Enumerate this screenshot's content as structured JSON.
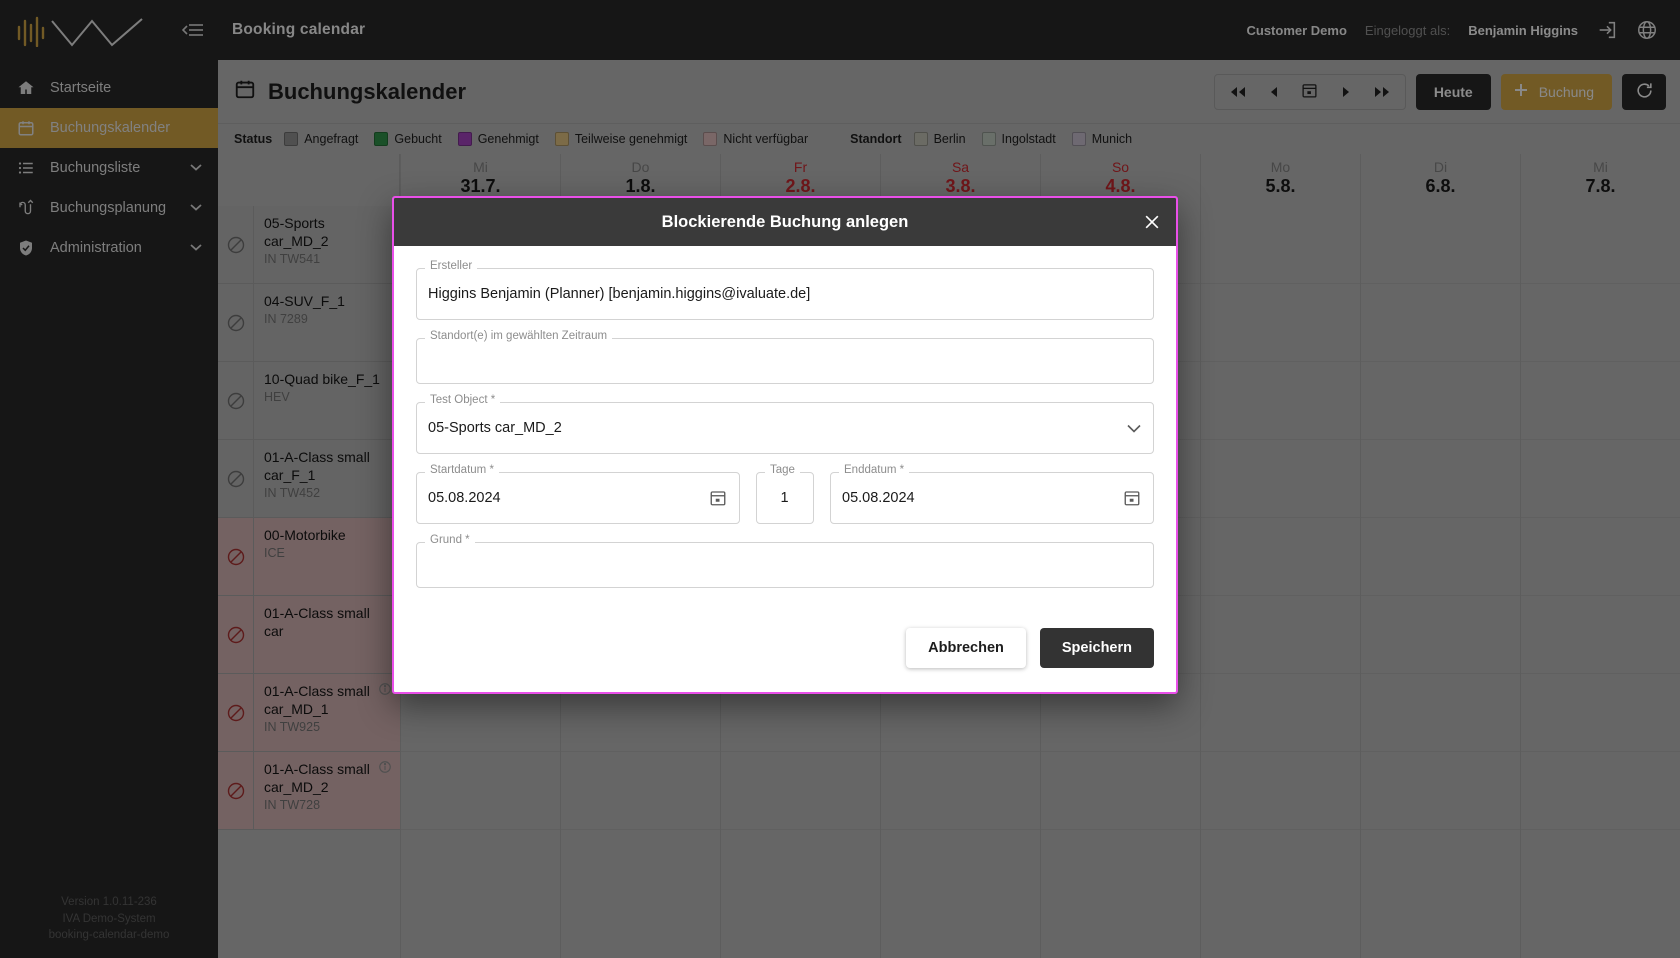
{
  "sidebar": {
    "logo_name": "iva-logo",
    "collapse_label": "collapse-sidebar",
    "items": [
      {
        "label": "Startseite",
        "icon": "home-icon",
        "active": false,
        "expandable": false
      },
      {
        "label": "Buchungskalender",
        "icon": "calendar-icon",
        "active": true,
        "expandable": false
      },
      {
        "label": "Buchungsliste",
        "icon": "list-icon",
        "active": false,
        "expandable": true
      },
      {
        "label": "Buchungsplanung",
        "icon": "shuffle-icon",
        "active": false,
        "expandable": true
      },
      {
        "label": "Administration",
        "icon": "shield-check-icon",
        "active": false,
        "expandable": true
      }
    ],
    "footer": {
      "version": "Version 1.0.11-236",
      "system": "IVA Demo-System",
      "tenant": "booking-calendar-demo"
    }
  },
  "topbar": {
    "title": "Booking calendar",
    "customer": "Customer Demo",
    "logged_in_label": "Eingeloggt als:",
    "user": "Benjamin Higgins",
    "logout_icon": "logout-icon",
    "language_icon": "globe-icon"
  },
  "page": {
    "title": "Buchungskalender",
    "title_icon": "calendar-icon",
    "nav": {
      "first_label": "◀◀",
      "prev_label": "◀",
      "today_picker_icon": "calendar-picker-icon",
      "next_label": "▶",
      "last_label": "▶▶"
    },
    "today_button": "Heute",
    "new_booking_button": "Buchung",
    "refresh_icon": "refresh-icon"
  },
  "legend": {
    "status_label": "Status",
    "statuses": [
      {
        "label": "Angefragt",
        "color": "#8b8b8b"
      },
      {
        "label": "Gebucht",
        "color": "#2e8b45"
      },
      {
        "label": "Genehmigt",
        "color": "#9b3fb5"
      },
      {
        "label": "Teilweise genehmigt",
        "color": "#d6b97b"
      },
      {
        "label": "Nicht verfügbar",
        "color": "#d2b2b2"
      }
    ],
    "location_label": "Standort",
    "locations": [
      {
        "label": "Berlin",
        "color": "#b8b8ad"
      },
      {
        "label": "Ingolstadt",
        "color": "#b6c0b6"
      },
      {
        "label": "Munich",
        "color": "#bdb6c4"
      }
    ]
  },
  "calendar": {
    "days": [
      {
        "name": "Mi",
        "num": "31.7.",
        "weekend": false
      },
      {
        "name": "Do",
        "num": "1.8.",
        "weekend": false
      },
      {
        "name": "Fr",
        "num": "2.8.",
        "weekend": true
      },
      {
        "name": "Sa",
        "num": "3.8.",
        "weekend": true
      },
      {
        "name": "So",
        "num": "4.8.",
        "weekend": true
      },
      {
        "name": "Mo",
        "num": "5.8.",
        "weekend": false
      },
      {
        "name": "Di",
        "num": "6.8.",
        "weekend": false
      },
      {
        "name": "Mi",
        "num": "7.8.",
        "weekend": false
      }
    ],
    "resources": [
      {
        "title": "05-Sports car_MD_2",
        "sub": "IN TW541",
        "state": "grey",
        "info": false,
        "block_icon": "blocked-icon"
      },
      {
        "title": "04-SUV_F_1",
        "sub": "IN 7289",
        "state": "grey",
        "info": false,
        "block_icon": "blocked-icon"
      },
      {
        "title": "10-Quad bike_F_1",
        "sub": "HEV",
        "state": "grey",
        "info": false,
        "block_icon": "blocked-icon"
      },
      {
        "title": "01-A-Class small car_F_1",
        "sub": "IN TW452",
        "state": "grey",
        "info": false,
        "block_icon": "blocked-icon"
      },
      {
        "title": "00-Motorbike",
        "sub": "ICE",
        "state": "red",
        "info": false,
        "block_icon": "blocked-icon"
      },
      {
        "title": "01-A-Class small car",
        "sub": "",
        "state": "red",
        "info": false,
        "block_icon": "blocked-icon"
      },
      {
        "title": "01-A-Class small car_MD_1",
        "sub": "IN TW925",
        "state": "red",
        "info": true,
        "block_icon": "blocked-icon"
      },
      {
        "title": "01-A-Class small car_MD_2",
        "sub": "IN TW728",
        "state": "red",
        "info": true,
        "block_icon": "blocked-icon"
      }
    ]
  },
  "modal": {
    "title": "Blockierende Buchung anlegen",
    "close_icon": "close-icon",
    "fields": {
      "ersteller": {
        "label": "Ersteller",
        "value": "Higgins Benjamin (Planner) [benjamin.higgins@ivaluate.de]"
      },
      "standorte": {
        "label": "Standort(e) im gewählten Zeitraum",
        "value": ""
      },
      "test_object": {
        "label": "Test Object *",
        "value": "05-Sports car_MD_2",
        "dropdown_icon": "chevron-down-icon"
      },
      "startdatum": {
        "label": "Startdatum *",
        "value": "05.08.2024",
        "picker_icon": "calendar-picker-icon"
      },
      "tage": {
        "label": "Tage",
        "value": "1"
      },
      "enddatum": {
        "label": "Enddatum *",
        "value": "05.08.2024",
        "picker_icon": "calendar-picker-icon"
      },
      "grund": {
        "label": "Grund *",
        "value": ""
      }
    },
    "cancel_button": "Abbrechen",
    "save_button": "Speichern"
  },
  "colors": {
    "accent_gold": "#c49b40",
    "dark": "#262626",
    "modal_border": "#e94fe9",
    "weekend_red": "#c1272d"
  }
}
